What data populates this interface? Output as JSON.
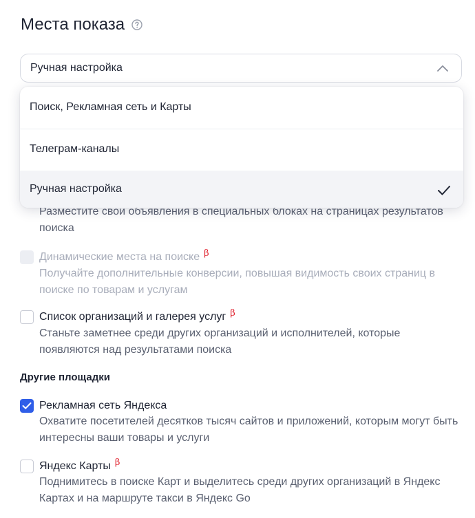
{
  "section_title": "Места показа",
  "select": {
    "value": "Ручная настройка"
  },
  "dropdown": {
    "options": [
      "Поиск, Рекламная сеть и Карты",
      "Телеграм-каналы",
      "Ручная настройка"
    ],
    "selected_index": 2
  },
  "search_items": {
    "partial_desc": "Разместите свои объявления в специальных блоках на страницах результатов поиска",
    "dynamic": {
      "label": "Динамические места на поиске",
      "beta": "β",
      "desc": "Получайте дополнительные конверсии, повышая видимость своих страниц в поиске по товарам и услугам",
      "checked": false,
      "disabled": true
    },
    "orgs": {
      "label": "Список организаций и галерея услуг",
      "beta": "β",
      "desc": "Станьте заметнее среди других организаций и исполнителей, которые появляются над результатами поиска",
      "checked": false
    }
  },
  "other": {
    "title": "Другие площадки",
    "network": {
      "label": "Рекламная сеть Яндекса",
      "desc": "Охватите посетителей десятков тысяч сайтов и приложений, которым могут быть интересны ваши товары и услуги",
      "checked": true
    },
    "maps": {
      "label": "Яндекс Карты",
      "beta": "β",
      "desc": "Поднимитесь в поиске Карт и выделитесь среди других организаций в Яндекс Картах и на маршруте такси в Яндекс Go",
      "checked": false
    }
  },
  "colors": {
    "accent": "#2f5ee8",
    "beta": "#e0202c",
    "text": "#1f2433",
    "muted": "#5a6070"
  }
}
